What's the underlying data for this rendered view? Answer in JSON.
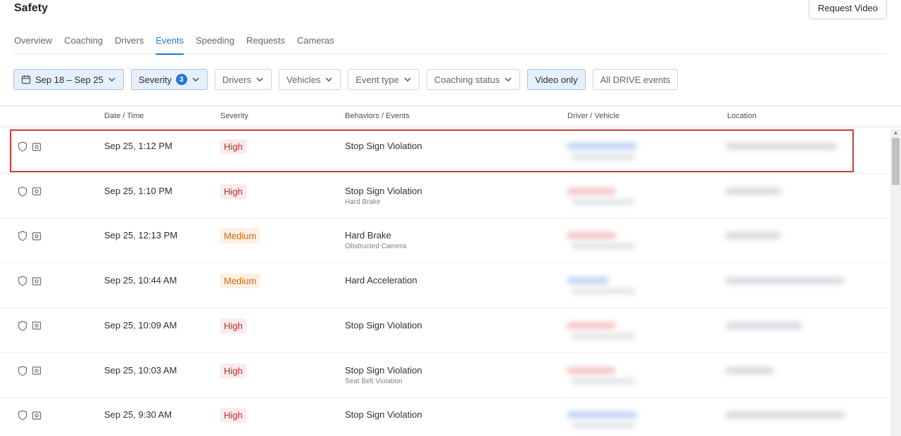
{
  "header": {
    "title": "Safety",
    "request_video_label": "Request Video"
  },
  "tabs": [
    {
      "label": "Overview",
      "active": false
    },
    {
      "label": "Coaching",
      "active": false
    },
    {
      "label": "Drivers",
      "active": false
    },
    {
      "label": "Events",
      "active": true
    },
    {
      "label": "Speeding",
      "active": false
    },
    {
      "label": "Requests",
      "active": false
    },
    {
      "label": "Cameras",
      "active": false
    }
  ],
  "filters": {
    "date_range": "Sep 18 – Sep 25",
    "severity": {
      "label": "Severity",
      "count": "3"
    },
    "drivers": "Drivers",
    "vehicles": "Vehicles",
    "event_type": "Event type",
    "coaching_status": "Coaching status",
    "video_only": "Video only",
    "all_drive_events": "All DRIVE events"
  },
  "table": {
    "columns": [
      "Date / Time",
      "Severity",
      "Behaviors / Events",
      "Driver / Vehicle",
      "Location"
    ],
    "rows": [
      {
        "datetime": "Sep 25, 1:12 PM",
        "severity": "High",
        "behavior": "Stop Sign Violation",
        "secondary": ""
      },
      {
        "datetime": "Sep 25, 1:10 PM",
        "severity": "High",
        "behavior": "Stop Sign Violation",
        "secondary": "Hard Brake"
      },
      {
        "datetime": "Sep 25, 12:13 PM",
        "severity": "Medium",
        "behavior": "Hard Brake",
        "secondary": "Obstructed Camera"
      },
      {
        "datetime": "Sep 25, 10:44 AM",
        "severity": "Medium",
        "behavior": "Hard Acceleration",
        "secondary": ""
      },
      {
        "datetime": "Sep 25, 10:09 AM",
        "severity": "High",
        "behavior": "Stop Sign Violation",
        "secondary": ""
      },
      {
        "datetime": "Sep 25, 10:03 AM",
        "severity": "High",
        "behavior": "Stop Sign Violation",
        "secondary": "Seat Belt Violation"
      },
      {
        "datetime": "Sep 25, 9:30 AM",
        "severity": "High",
        "behavior": "Stop Sign Violation",
        "secondary": ""
      }
    ]
  },
  "colors": {
    "accent": "#1f7ad6",
    "high": "#c62828",
    "medium": "#d06a14",
    "highlight_border": "#c93c3c"
  },
  "icons": {
    "date_filter": "calendar-icon",
    "dropdown": "chevron-down-icon",
    "row_icons": [
      "shield-icon",
      "camera-icon"
    ]
  }
}
